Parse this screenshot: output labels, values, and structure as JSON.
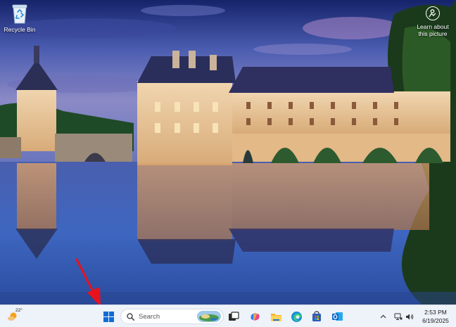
{
  "desktop": {
    "recycle_bin": {
      "label": "Recycle Bin",
      "icon": "recycle-bin-icon"
    },
    "learn_about": {
      "label": "Learn about this picture",
      "icon": "camera-icon"
    }
  },
  "taskbar": {
    "weather": {
      "temperature": "22°",
      "icon": "sun-cloud-icon"
    },
    "start": {
      "icon": "windows-logo-icon"
    },
    "search": {
      "placeholder": "Search",
      "icon": "search-icon"
    },
    "apps": [
      {
        "name": "Task View",
        "icon": "task-view-icon"
      },
      {
        "name": "Copilot",
        "icon": "copilot-icon"
      },
      {
        "name": "File Explorer",
        "icon": "folder-icon"
      },
      {
        "name": "Microsoft Edge",
        "icon": "edge-icon"
      },
      {
        "name": "Microsoft Store",
        "icon": "store-icon"
      },
      {
        "name": "Outlook",
        "icon": "outlook-icon"
      }
    ],
    "tray": {
      "chevron": "^",
      "icons": [
        "network-icon",
        "speaker-icon"
      ]
    },
    "clock": {
      "time": "2:53 PM",
      "date": "6/19/2025"
    }
  },
  "colors": {
    "taskbar_bg": "#eef2f9",
    "start_blue": "#0f6cd6",
    "arrow_red": "#e8121c"
  }
}
